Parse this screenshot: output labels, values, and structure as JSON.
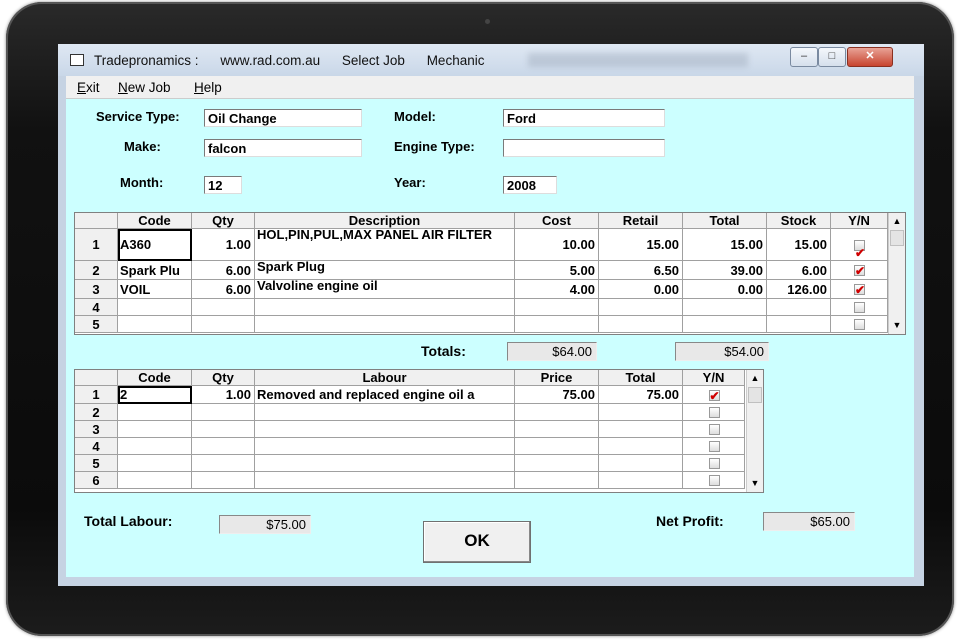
{
  "window": {
    "title_items": [
      "Tradepronamics :",
      "www.rad.com.au",
      "Select Job",
      "Mechanic"
    ],
    "controls": {
      "minimize": "–",
      "maximize": "□",
      "close": "✕"
    }
  },
  "menu": [
    {
      "label": "Exit"
    },
    {
      "label": "New Job"
    },
    {
      "label": "Help"
    }
  ],
  "form": {
    "service_type": {
      "label": "Service Type:",
      "value": "Oil Change"
    },
    "model": {
      "label": "Model:",
      "value": "Ford"
    },
    "make": {
      "label": "Make:",
      "value": "falcon"
    },
    "engine_type": {
      "label": "Engine Type:",
      "value": ""
    },
    "month": {
      "label": "Month:",
      "value": "12"
    },
    "year": {
      "label": "Year:",
      "value": "2008"
    }
  },
  "parts": {
    "columns": [
      "Code",
      "Qty",
      "Description",
      "Cost",
      "Retail",
      "Total",
      "Stock",
      "Y/N"
    ],
    "rows": [
      {
        "n": "1",
        "code": "A360",
        "qty": "1.00",
        "description": "HOL,PIN,PUL,MAX PANEL AIR FILTER",
        "cost": "10.00",
        "retail": "15.00",
        "total": "15.00",
        "stock": "15.00",
        "yn": true
      },
      {
        "n": "2",
        "code": "Spark Plu",
        "qty": "6.00",
        "description": "Spark Plug",
        "cost": "5.00",
        "retail": "6.50",
        "total": "39.00",
        "stock": "6.00",
        "yn": true
      },
      {
        "n": "3",
        "code": "VOIL",
        "qty": "6.00",
        "description": "Valvoline engine oil",
        "cost": "4.00",
        "retail": "0.00",
        "total": "0.00",
        "stock": "126.00",
        "yn": true
      },
      {
        "n": "4",
        "code": "",
        "qty": "",
        "description": "",
        "cost": "",
        "retail": "",
        "total": "",
        "stock": "",
        "yn": false
      },
      {
        "n": "5",
        "code": "",
        "qty": "",
        "description": "",
        "cost": "",
        "retail": "",
        "total": "",
        "stock": "",
        "yn": false
      }
    ]
  },
  "totals": {
    "label": "Totals:",
    "cost_total": "$64.00",
    "total_total": "$54.00"
  },
  "labour": {
    "columns": [
      "Code",
      "Qty",
      "Labour",
      "Price",
      "Total",
      "Y/N"
    ],
    "rows": [
      {
        "n": "1",
        "code": "2",
        "qty": "1.00",
        "labour": "Removed and replaced engine oil a",
        "price": "75.00",
        "total": "75.00",
        "yn": true
      },
      {
        "n": "2",
        "code": "",
        "qty": "",
        "labour": "",
        "price": "",
        "total": "",
        "yn": false
      },
      {
        "n": "3",
        "code": "",
        "qty": "",
        "labour": "",
        "price": "",
        "total": "",
        "yn": false
      },
      {
        "n": "4",
        "code": "",
        "qty": "",
        "labour": "",
        "price": "",
        "total": "",
        "yn": false
      },
      {
        "n": "5",
        "code": "",
        "qty": "",
        "labour": "",
        "price": "",
        "total": "",
        "yn": false
      },
      {
        "n": "6",
        "code": "",
        "qty": "",
        "labour": "",
        "price": "",
        "total": "",
        "yn": false
      }
    ]
  },
  "summary": {
    "total_labour": {
      "label": "Total Labour:",
      "value": "$75.00"
    },
    "net_profit": {
      "label": "Net Profit:",
      "value": "$65.00"
    },
    "ok_label": "OK"
  },
  "colors": {
    "client_bg": "#ccffff",
    "check": "#d00000"
  },
  "icons": {
    "scroll_up": "▲",
    "scroll_down": "▼"
  }
}
